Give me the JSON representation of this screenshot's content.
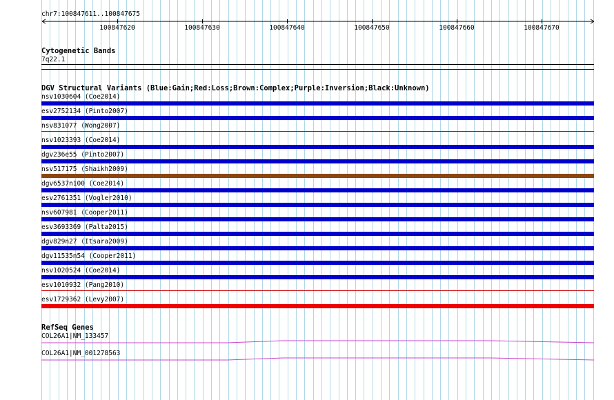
{
  "ruler": {
    "region": "chr7:100847611..100847675",
    "ticks": [
      "100847620",
      "100847630",
      "100847640",
      "100847650",
      "100847660",
      "100847670"
    ]
  },
  "cytobands": {
    "title": "Cytogenetic Bands",
    "band": "7q22.1"
  },
  "dgv": {
    "title": "DGV Structural Variants (Blue:Gain;Red:Loss;Brown:Complex;Purple:Inversion;Black:Unknown)",
    "variants": [
      {
        "label": "nsv1030604 (Coe2014)",
        "type": "gain",
        "color": "#0000cc"
      },
      {
        "label": "esv2752134 (Pinto2007)",
        "type": "gain",
        "color": "#0000cc"
      },
      {
        "label": "nsv831077 (Wong2007)",
        "type": "loss",
        "color": "#cc0000"
      },
      {
        "label": "nsv1023393 (Coe2014)",
        "type": "gain",
        "color": "#0000cc"
      },
      {
        "label": "dgv236e55 (Pinto2007)",
        "type": "gain",
        "color": "#0000cc"
      },
      {
        "label": "nsv517175 (Shaikh2009)",
        "type": "complex",
        "color": "#8b4513"
      },
      {
        "label": "dgv6537n100 (Coe2014)",
        "type": "gain",
        "color": "#0000cc"
      },
      {
        "label": "esv2761351 (Vogler2010)",
        "type": "gain",
        "color": "#0000cc"
      },
      {
        "label": "nsv607981 (Cooper2011)",
        "type": "gain",
        "color": "#0000cc"
      },
      {
        "label": "esv3693369 (Palta2015)",
        "type": "gain",
        "color": "#0000cc"
      },
      {
        "label": "dgv829n27 (Itsara2009)",
        "type": "gain",
        "color": "#0000cc"
      },
      {
        "label": "dgv11535n54 (Cooper2011)",
        "type": "gain",
        "color": "#0000cc"
      },
      {
        "label": "nsv1020524 (Coe2014)",
        "type": "gain",
        "color": "#0000cc"
      },
      {
        "label": "esv1010932 (Pang2010)",
        "type": "loss",
        "color": "#cc0000"
      },
      {
        "label": "esv1729362 (Levy2007)",
        "type": "loss",
        "color": "#ee0000"
      }
    ]
  },
  "refseq": {
    "title": "RefSeq Genes",
    "genes": [
      {
        "label": "COL26A1|NM_133457",
        "color": "#cc44cc"
      },
      {
        "label": "COL26A1|NM_001278563",
        "color": "#cc44cc"
      }
    ]
  }
}
